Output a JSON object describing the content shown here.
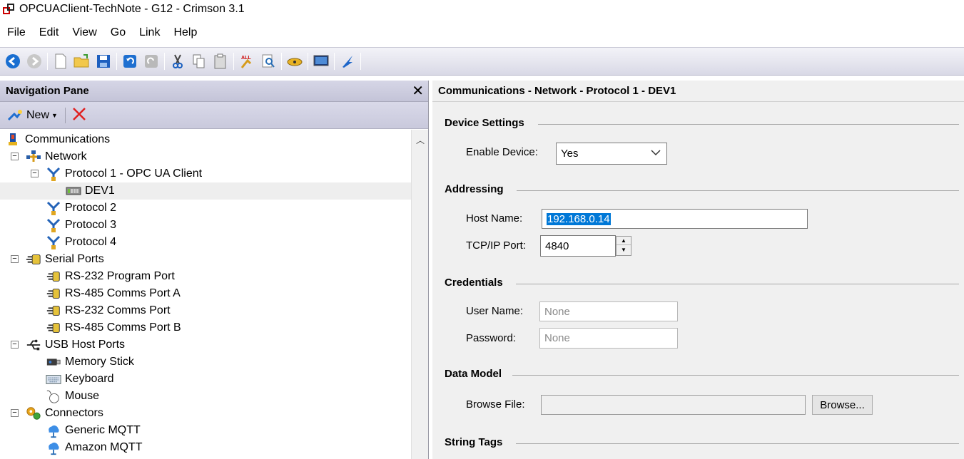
{
  "window": {
    "title": "OPCUAClient-TechNote - G12 - Crimson 3.1"
  },
  "menu": [
    "File",
    "Edit",
    "View",
    "Go",
    "Link",
    "Help"
  ],
  "nav": {
    "header": "Navigation Pane",
    "new_label": "New",
    "tree": [
      {
        "label": "Communications",
        "icon": "communications-icon",
        "level": 0,
        "toggle": ""
      },
      {
        "label": "Network",
        "icon": "network-icon",
        "level": 1,
        "toggle": "−"
      },
      {
        "label": "Protocol 1 - OPC UA Client",
        "icon": "protocol-icon",
        "level": 2,
        "toggle": "−"
      },
      {
        "label": "DEV1",
        "icon": "device-icon",
        "level": 3,
        "toggle": "",
        "selected": true
      },
      {
        "label": "Protocol 2",
        "icon": "protocol-icon",
        "level": 2,
        "toggle": ""
      },
      {
        "label": "Protocol 3",
        "icon": "protocol-icon",
        "level": 2,
        "toggle": ""
      },
      {
        "label": "Protocol 4",
        "icon": "protocol-icon",
        "level": 2,
        "toggle": ""
      },
      {
        "label": "Serial Ports",
        "icon": "serial-port-icon",
        "level": 1,
        "toggle": "−"
      },
      {
        "label": "RS-232 Program Port",
        "icon": "port-icon",
        "level": 2,
        "toggle": ""
      },
      {
        "label": "RS-485 Comms Port A",
        "icon": "port-icon",
        "level": 2,
        "toggle": ""
      },
      {
        "label": "RS-232 Comms Port",
        "icon": "port-icon",
        "level": 2,
        "toggle": ""
      },
      {
        "label": "RS-485 Comms Port B",
        "icon": "port-icon",
        "level": 2,
        "toggle": ""
      },
      {
        "label": "USB Host Ports",
        "icon": "usb-icon",
        "level": 1,
        "toggle": "−"
      },
      {
        "label": "Memory Stick",
        "icon": "memory-stick-icon",
        "level": 2,
        "toggle": ""
      },
      {
        "label": "Keyboard",
        "icon": "keyboard-icon",
        "level": 2,
        "toggle": ""
      },
      {
        "label": "Mouse",
        "icon": "mouse-icon",
        "level": 2,
        "toggle": ""
      },
      {
        "label": "Connectors",
        "icon": "connectors-icon",
        "level": 1,
        "toggle": "−"
      },
      {
        "label": "Generic MQTT",
        "icon": "cloud-icon",
        "level": 2,
        "toggle": ""
      },
      {
        "label": "Amazon MQTT",
        "icon": "cloud-icon",
        "level": 2,
        "toggle": ""
      }
    ]
  },
  "main": {
    "header": "Communications - Network - Protocol 1 - DEV1",
    "device_settings": {
      "title": "Device Settings",
      "enable_label": "Enable Device:",
      "enable_value": "Yes"
    },
    "addressing": {
      "title": "Addressing",
      "host_label": "Host Name:",
      "host_value": "192.168.0.14",
      "port_label": "TCP/IP Port:",
      "port_value": "4840"
    },
    "credentials": {
      "title": "Credentials",
      "user_label": "User Name:",
      "user_placeholder": "None",
      "password_label": "Password:",
      "password_placeholder": "None"
    },
    "data_model": {
      "title": "Data Model",
      "browse_label": "Browse File:",
      "browse_button": "Browse..."
    },
    "string_tags": {
      "title": "String Tags"
    }
  }
}
